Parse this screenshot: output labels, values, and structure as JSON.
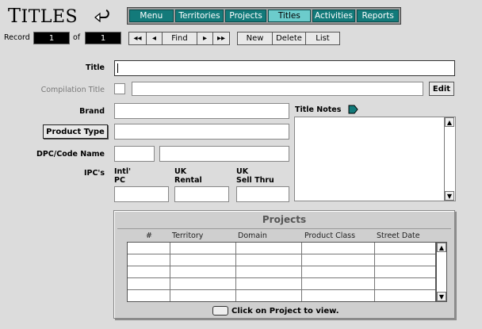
{
  "header": {
    "title_first": "T",
    "title_rest": "ITLES"
  },
  "nav": {
    "tabs": [
      {
        "label": "Menu",
        "active": false
      },
      {
        "label": "Territories",
        "active": false
      },
      {
        "label": "Projects",
        "active": false
      },
      {
        "label": "Titles",
        "active": true
      },
      {
        "label": "Activities",
        "active": false
      },
      {
        "label": "Reports",
        "active": false
      }
    ]
  },
  "record": {
    "label": "Record",
    "current": "1",
    "of_label": "of",
    "total": "1"
  },
  "navigation": {
    "first": "◂◂",
    "prev": "◂",
    "find": "Find",
    "next": "▸",
    "last": "▸▸"
  },
  "actions": {
    "new": "New",
    "delete": "Delete",
    "list": "List"
  },
  "form": {
    "title_label": "Title",
    "compilation_label": "Compilation Title",
    "edit_button": "Edit",
    "brand_label": "Brand",
    "product_type_button": "Product Type",
    "dpc_label": "DPC/Code Name",
    "ipc_label": "IPC's",
    "intl_pc_label_1": "Intl'",
    "intl_pc_label_2": "PC",
    "uk_rental_label_1": "UK",
    "uk_rental_label_2": "Rental",
    "uk_sell_label_1": "UK",
    "uk_sell_label_2": "Sell Thru",
    "title_notes_label": "Title Notes"
  },
  "projects": {
    "heading": "Projects",
    "columns": [
      "#",
      "Territory",
      "Domain",
      "Product Class",
      "Street Date"
    ],
    "hint": "Click on Project to view."
  },
  "colors": {
    "accent": "#137a7a",
    "active_tab": "#6ccccc"
  }
}
